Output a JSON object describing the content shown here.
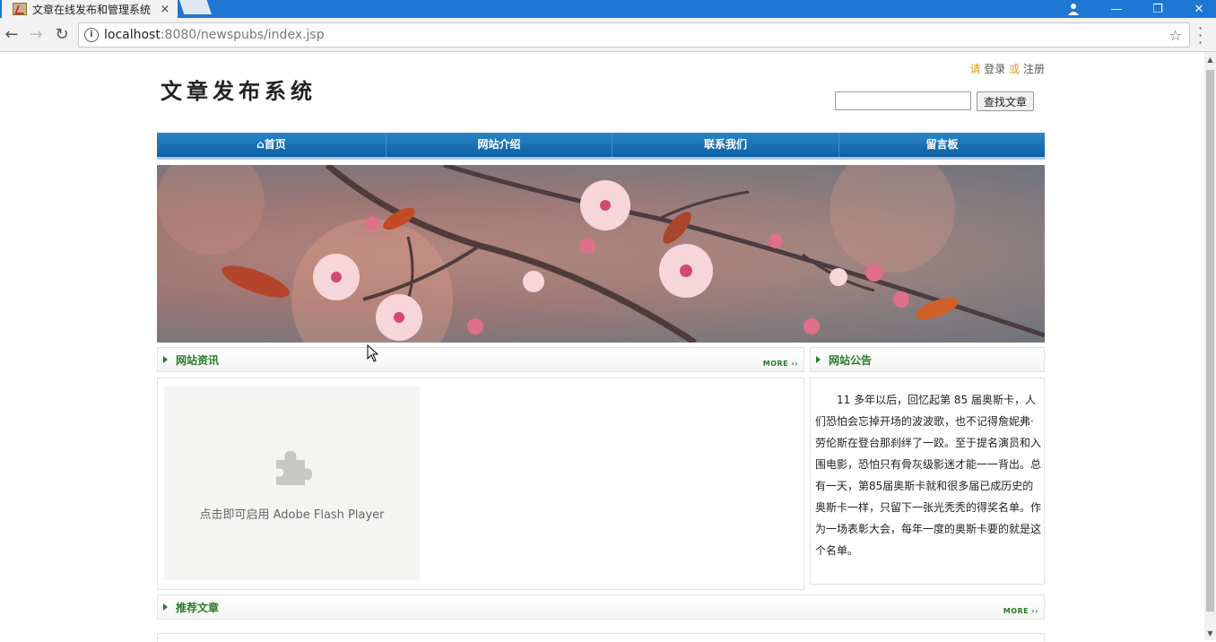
{
  "browser": {
    "tab_title": "文章在线发布和管理系统",
    "tab_close": "×",
    "url_host": "localhost",
    "url_rest": ":8080/newspubs/index.jsp",
    "window_controls": [
      "—",
      "❐",
      "✕"
    ]
  },
  "header": {
    "logo": "文章发布系统",
    "auth": {
      "please": "请",
      "login": "登录",
      "or": "或",
      "register": "注册"
    },
    "search_button": "查找文章",
    "search_value": ""
  },
  "nav": [
    {
      "label": "首页",
      "icon": "home-icon"
    },
    {
      "label": "网站介绍"
    },
    {
      "label": "联系我们"
    },
    {
      "label": "留言板"
    }
  ],
  "news": {
    "title": "网站资讯",
    "more": "MORE ››",
    "flash_caption": "点击即可启用 Adobe Flash Player"
  },
  "notice": {
    "title": "网站公告",
    "text": "11 多年以后，回忆起第 85 届奥斯卡，人们恐怕会忘掉开场的波波歌，也不记得詹妮弗·劳伦斯在登台那刹绊了一跤。至于提名演员和入围电影，恐怕只有骨灰级影迷才能一一背出。总有一天，第85届奥斯卡就和很多届已成历史的奥斯卡一样，只留下一张光秃秃的得奖名单。作为一场表彰大会，每年一度的奥斯卡要的就是这个名单。"
  },
  "recommend": {
    "title": "推荐文章",
    "more": "MORE ››"
  },
  "colors": {
    "nav_blue": "#1a6fb5",
    "section_green": "#2a7a2a",
    "auth_orange": "#e59a1c",
    "tabbar_blue": "#1e77d3"
  }
}
